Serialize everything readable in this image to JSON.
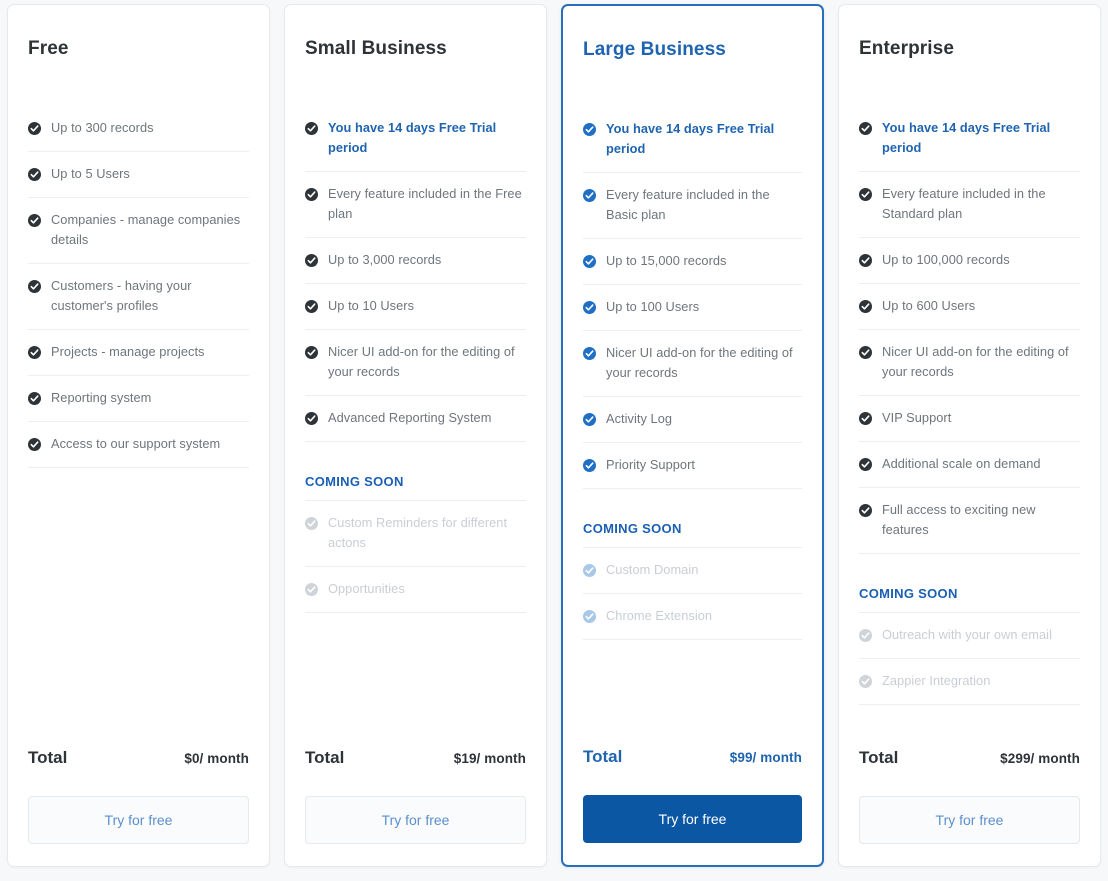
{
  "theme": {
    "accent_blue": "#1f64b0",
    "cta_primary_bg": "#0b57a4",
    "cta_secondary_text": "#5b8fce",
    "muted_text": "#6e757c",
    "soon_text": "#c9ced4",
    "page_bg": "#f7f8f9"
  },
  "cta_label": "Try for free",
  "total_label": "Total",
  "coming_soon_label": "COMING SOON",
  "check_icon_name": "check-circle-icon",
  "plans": [
    {
      "name": "Free",
      "featured": false,
      "price": "$0/ month",
      "features": [
        {
          "text": "Up to 300 records",
          "style": "normal"
        },
        {
          "text": "Up to 5 Users",
          "style": "normal"
        },
        {
          "text": "Companies - manage companies details",
          "style": "normal"
        },
        {
          "text": "Customers - having your customer's profiles",
          "style": "normal"
        },
        {
          "text": "Projects - manage projects",
          "style": "normal"
        },
        {
          "text": "Reporting system",
          "style": "normal"
        },
        {
          "text": "Access to our support system",
          "style": "normal"
        }
      ],
      "coming_soon": []
    },
    {
      "name": "Small Business",
      "featured": false,
      "price": "$19/ month",
      "features": [
        {
          "text": "You have 14 days Free Trial period",
          "style": "trial"
        },
        {
          "text": "Every feature included in the Free plan",
          "style": "normal"
        },
        {
          "text": "Up to 3,000 records",
          "style": "normal"
        },
        {
          "text": "Up to 10 Users",
          "style": "normal"
        },
        {
          "text": "Nicer UI add-on for the editing of your records",
          "style": "normal"
        },
        {
          "text": "Advanced Reporting System",
          "style": "normal"
        }
      ],
      "coming_soon": [
        {
          "text": "Custom Reminders for different actons",
          "style": "soon"
        },
        {
          "text": "Opportunities",
          "style": "soon"
        }
      ]
    },
    {
      "name": "Large Business",
      "featured": true,
      "price": "$99/ month",
      "features": [
        {
          "text": "You have 14 days Free Trial period",
          "style": "trial"
        },
        {
          "text": "Every feature included in the Basic plan",
          "style": "normal"
        },
        {
          "text": "Up to 15,000 records",
          "style": "normal"
        },
        {
          "text": "Up to 100 Users",
          "style": "normal"
        },
        {
          "text": "Nicer UI add-on for the editing of your records",
          "style": "normal"
        },
        {
          "text": "Activity Log",
          "style": "normal"
        },
        {
          "text": "Priority Support",
          "style": "normal"
        }
      ],
      "coming_soon": [
        {
          "text": "Custom Domain",
          "style": "soon"
        },
        {
          "text": "Chrome Extension",
          "style": "soon"
        }
      ]
    },
    {
      "name": "Enterprise",
      "featured": false,
      "price": "$299/ month",
      "features": [
        {
          "text": "You have 14 days Free Trial period",
          "style": "trial"
        },
        {
          "text": "Every feature included in the Standard plan",
          "style": "normal"
        },
        {
          "text": "Up to 100,000 records",
          "style": "normal"
        },
        {
          "text": "Up to 600 Users",
          "style": "normal"
        },
        {
          "text": "Nicer UI add-on for the editing of your records",
          "style": "normal"
        },
        {
          "text": "VIP Support",
          "style": "normal"
        },
        {
          "text": "Additional scale on demand",
          "style": "normal"
        },
        {
          "text": "Full access to exciting new features",
          "style": "normal"
        }
      ],
      "coming_soon": [
        {
          "text": "Outreach with your own email",
          "style": "soon"
        },
        {
          "text": "Zappier Integration",
          "style": "soon"
        }
      ]
    }
  ]
}
